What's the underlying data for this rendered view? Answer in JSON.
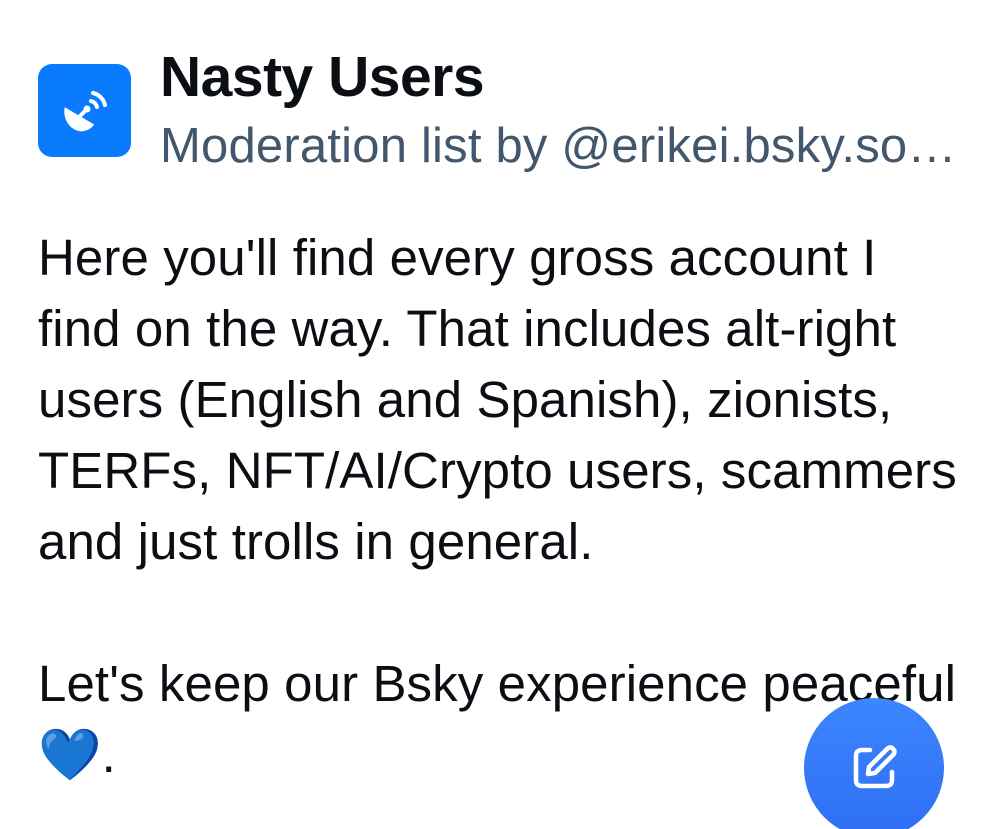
{
  "list": {
    "icon": "satellite-dish-icon",
    "title": "Nasty Users",
    "subtitle": "Moderation list by @erikei.bsky.social",
    "description": "Here you'll find every gross account I find on the way. That includes alt-right users (English and Spanish), zionists, TERFs, NFT/AI/Crypto users, scammers and just trolls in general.\n\nLet's keep our Bsky experience peaceful 💙."
  },
  "compose_button": {
    "icon": "compose-icon"
  },
  "colors": {
    "brand_blue": "#0a7aff",
    "fab_blue": "#3a7ffb",
    "subtitle_gray": "#42576c",
    "text": "#0b0f14"
  }
}
